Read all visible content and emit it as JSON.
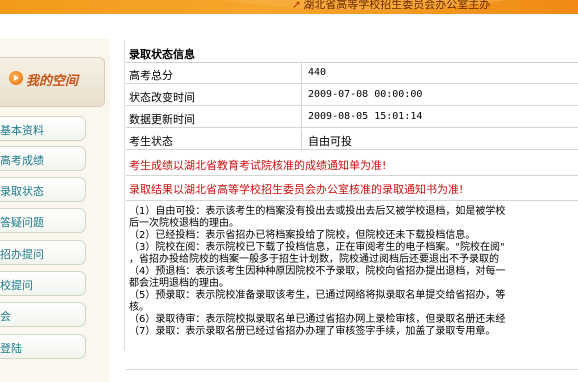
{
  "banner": {
    "text": "湖北省高等学校招生委员会办公室主办"
  },
  "sidebar": {
    "my_space": "我的空间",
    "items": [
      {
        "label": "基本资料"
      },
      {
        "label": "高考成绩"
      },
      {
        "label": "录取状态"
      },
      {
        "label": "答疑问题"
      },
      {
        "label": "招办提问"
      },
      {
        "label": "校提问"
      },
      {
        "label": "会"
      },
      {
        "label": "登陆"
      }
    ]
  },
  "main": {
    "section_title": "录取状态信息",
    "rows": [
      {
        "label": "高考总分",
        "value": "440"
      },
      {
        "label": "状态改变时间",
        "value": "2009-07-08 00:00:00"
      },
      {
        "label": "数据更新时间",
        "value": "2009-08-05 15:01:14"
      },
      {
        "label": "考生状态",
        "value": "自由可投"
      }
    ],
    "notice1": "考生成绩以湖北省教育考试院核准的成绩通知单为准!",
    "notice2": "录取结果以湖北省高等学校招生委员会办公室核准的录取通知书为准!",
    "notes": [
      "（1）自由可投：表示该考生的档案没有投出去或投出去后又被学校退档，如是被学校",
      "后一次院校退档的理由。",
      "（2）已经投档：表示省招办已将档案投给了院校，但院校还未下载投档信息。",
      "（3）院校在阅：表示院校已下载了投档信息，正在审阅考生的电子档案。\"院校在阅\"",
      "，省招办投给院校的档案一般多于招生计划数，院校通过阅档后还要退出不予录取的",
      "（4）预退档：表示该考生因种种原因院校不予录取，院校向省招办提出退档，对每一",
      "都会注明退档的理由。",
      "（5）预录取：表示院校准备录取该考生，已通过网络将拟录取名单提交给省招办，等",
      "核。",
      "（6）录取待审：表示院校拟录取名单已通过省招办网上录检审核，但录取名册还未经",
      "（7）录取：表示录取名册已经过省招办办理了审核签字手续，加盖了录取专用章。"
    ]
  },
  "colors": {
    "banner": "#f39a1b",
    "notice_red": "#cc1111",
    "menu_text": "#1d7a8c",
    "my_space_text": "#c8541b"
  }
}
